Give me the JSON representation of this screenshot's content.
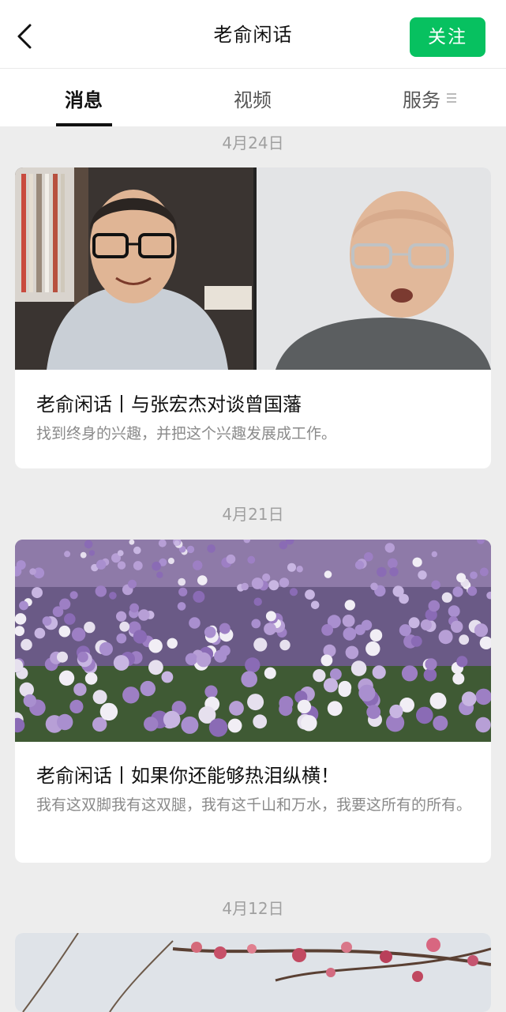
{
  "header": {
    "title": "老俞闲话",
    "follow_label": "关注"
  },
  "tabs": [
    {
      "label": "消息",
      "active": true
    },
    {
      "label": "视频",
      "active": false
    },
    {
      "label": "服务",
      "active": false
    }
  ],
  "feed": [
    {
      "date": "4月24日",
      "title": "老俞闲话丨与张宏杰对谈曾国藩",
      "desc": "找到终身的兴趣，并把这个兴趣发展成工作。",
      "image": "video-call-two-men"
    },
    {
      "date": "4月21日",
      "title": "老俞闲话丨如果你还能够热泪纵横！",
      "desc": "我有这双脚我有这双腿，我有这千山和万水，我要这所有的所有。",
      "image": "purple-flower-field"
    },
    {
      "date": "4月12日",
      "image": "plum-blossom-branches"
    }
  ],
  "colors": {
    "accent": "#07c160",
    "background": "#ededed"
  }
}
